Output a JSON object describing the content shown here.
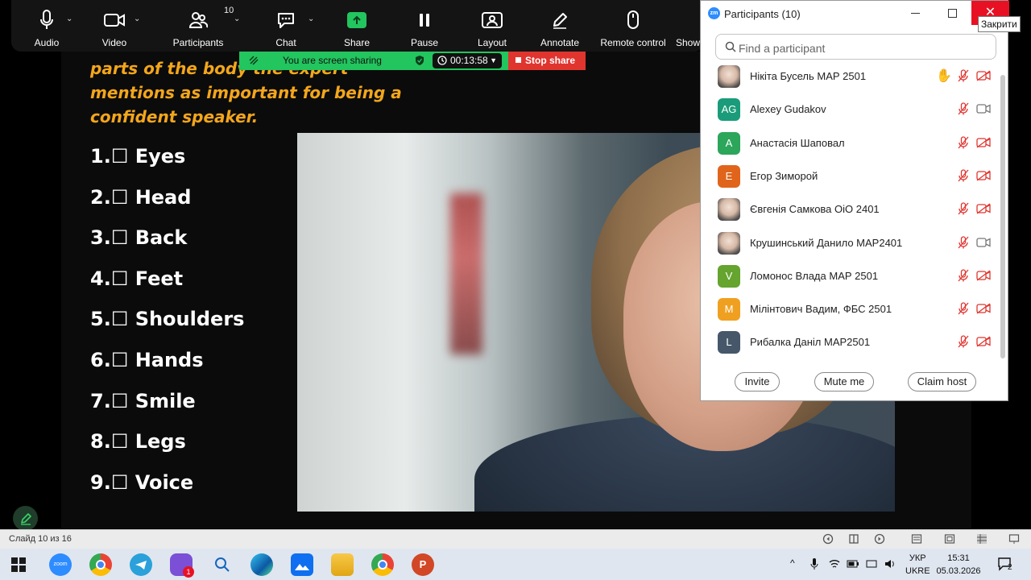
{
  "toolbar": {
    "audio": "Audio",
    "video": "Video",
    "participants": "Participants",
    "participants_count": "10",
    "chat": "Chat",
    "share": "Share",
    "pause": "Pause",
    "layout": "Layout",
    "annotate": "Annotate",
    "remote_control": "Remote control",
    "show": "Show"
  },
  "share_bar": {
    "status": "You are screen sharing",
    "timer": "00:13:58",
    "stop": "Stop share"
  },
  "slide": {
    "heading_lines": [
      "parts of the body the expert",
      "mentions as important for being a",
      "confident speaker."
    ],
    "items": [
      "1.☐ Eyes",
      "2.☐ Head",
      "3.☐ Back",
      "4.☐ Feet",
      "5.☐ Shoulders",
      "6.☐ Hands",
      "7.☐ Smile",
      "8.☐ Legs",
      "9.☐ Voice"
    ]
  },
  "participants_window": {
    "logo": "zm",
    "title": "Participants (10)",
    "close_tooltip": "Закрити",
    "search_placeholder": "Find a participant",
    "participants": [
      {
        "name": "Нікіта Бусель МАР 2501",
        "avatar": "",
        "avatar_color": "photo",
        "hand_raised": true,
        "video": "off"
      },
      {
        "name": "Alexey Gudakov",
        "avatar": "AG",
        "avatar_color": "#1a9c7a",
        "hand_raised": false,
        "video": "on"
      },
      {
        "name": "Анастасія Шаповал",
        "avatar": "A",
        "avatar_color": "#2ba65a",
        "hand_raised": false,
        "video": "off"
      },
      {
        "name": "Егор Зиморой",
        "avatar": "E",
        "avatar_color": "#e0651b",
        "hand_raised": false,
        "video": "off"
      },
      {
        "name": "Євгенія Самкова ОіО 2401",
        "avatar": "",
        "avatar_color": "photo",
        "hand_raised": false,
        "video": "off"
      },
      {
        "name": "Крушинський Данило МАР2401",
        "avatar": "",
        "avatar_color": "photo",
        "hand_raised": false,
        "video": "on"
      },
      {
        "name": "Ломонос Влада МАР 2501",
        "avatar": "V",
        "avatar_color": "#65a42f",
        "hand_raised": false,
        "video": "off"
      },
      {
        "name": "Мілінтович Вадим, ФБС 2501",
        "avatar": "M",
        "avatar_color": "#f0a020",
        "hand_raised": false,
        "video": "off"
      },
      {
        "name": "Рибалка Даніл МАР2501",
        "avatar": "L",
        "avatar_color": "#46576a",
        "hand_raised": false,
        "video": "off"
      }
    ],
    "buttons": {
      "invite": "Invite",
      "mute_me": "Mute me",
      "claim_host": "Claim host"
    }
  },
  "statusbar": {
    "slide": "Слайд 10 из 16"
  },
  "taskbar": {
    "zoom_label": "zoom",
    "viber_badge": "1",
    "lang_top": "УКР",
    "lang_bottom": "UKRE",
    "time": "15:31",
    "date": "05.03.2026",
    "notifications": "2"
  }
}
